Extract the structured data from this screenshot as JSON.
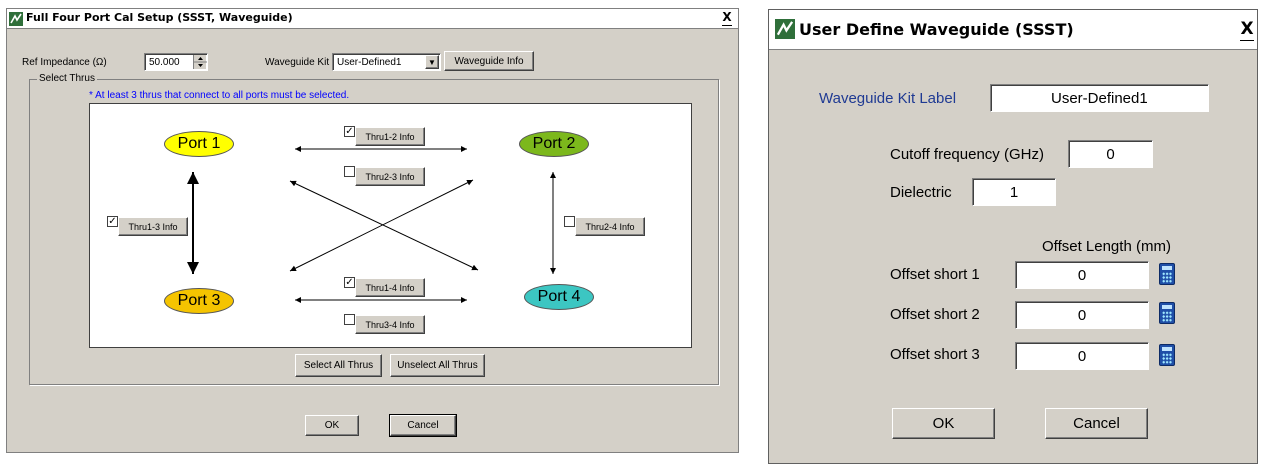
{
  "left_dialog": {
    "title": "Full Four Port Cal Setup (SSST, Waveguide)",
    "close_label": "X",
    "ref_impedance_label": "Ref Impedance (Ω)",
    "ref_impedance_value": "50.000",
    "waveguide_kit_label": "Waveguide Kit",
    "waveguide_kit_value": "User-Defined1",
    "waveguide_info_label": "Waveguide Info",
    "select_thrus_label": "Select Thrus",
    "note": "* At least 3 thrus that connect to all ports must be selected.",
    "ports": {
      "p1": "Port 1",
      "p2": "Port 2",
      "p3": "Port 3",
      "p4": "Port 4"
    },
    "thrus": {
      "t12": {
        "label": "Thru1-2 Info",
        "check": "✓"
      },
      "t23": {
        "label": "Thru2-3 Info",
        "check": ""
      },
      "t13": {
        "label": "Thru1-3 Info",
        "check": "✓"
      },
      "t24": {
        "label": "Thru2-4 Info",
        "check": ""
      },
      "t14": {
        "label": "Thru1-4 Info",
        "check": "✓"
      },
      "t34": {
        "label": "Thru3-4 Info",
        "check": ""
      }
    },
    "select_all_label": "Select All Thrus",
    "unselect_all_label": "Unselect All Thrus",
    "ok_label": "OK",
    "cancel_label": "Cancel"
  },
  "right_dialog": {
    "title": "User Define Waveguide (SSST)",
    "close_label": "X",
    "kit_label": "Waveguide Kit Label",
    "kit_value": "User-Defined1",
    "cutoff_label": "Cutoff frequency (GHz)",
    "cutoff_value": "0",
    "dielectric_label": "Dielectric",
    "dielectric_value": "1",
    "offset_header": "Offset Length (mm)",
    "offsets": [
      {
        "label": "Offset short 1",
        "value": "0"
      },
      {
        "label": "Offset short 2",
        "value": "0"
      },
      {
        "label": "Offset short 3",
        "value": "0"
      }
    ],
    "ok_label": "OK",
    "cancel_label": "Cancel"
  },
  "colors": {
    "dialog_bg": "#d4d0c8",
    "port1": "#ffff00",
    "port2": "#7cb81c",
    "port3": "#f5c400",
    "port4": "#3cc6c2",
    "note_text": "#0000ff",
    "kit_label_text": "#1f3a93"
  }
}
